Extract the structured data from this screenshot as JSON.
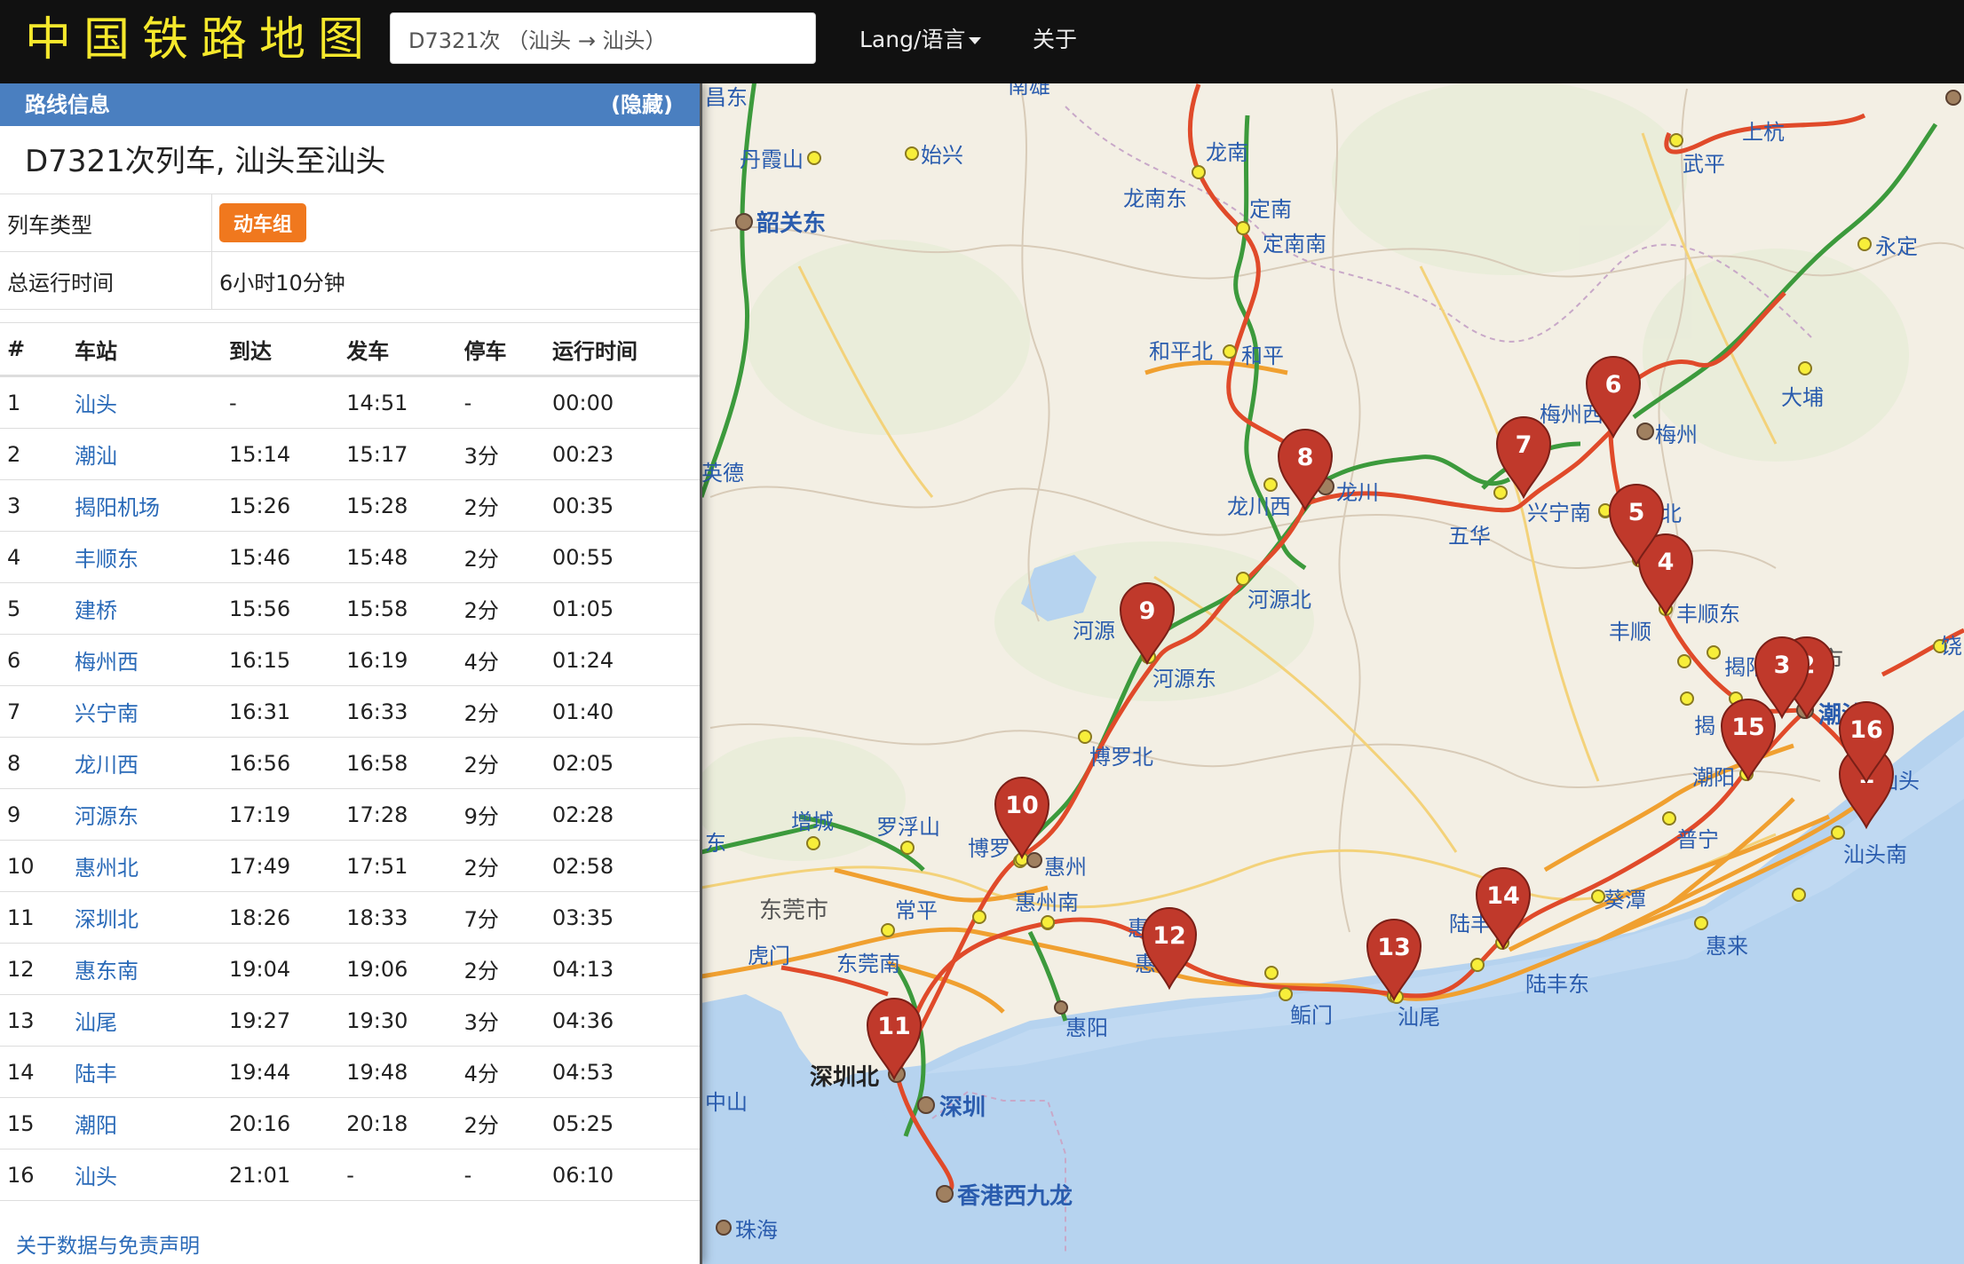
{
  "navbar": {
    "brand": "中国铁路地图",
    "search_value": "D7321次 （汕头 → 汕头）",
    "lang_label": "Lang/语言",
    "about_label": "关于"
  },
  "panel": {
    "header_title": "路线信息",
    "hide_label": "(隐藏)",
    "route_title": "D7321次列车, 汕头至汕头",
    "train_type_label": "列车类型",
    "train_type_value": "动车组",
    "total_time_label": "总运行时间",
    "total_time_value": "6小时10分钟",
    "columns": [
      "#",
      "车站",
      "到达",
      "发车",
      "停车",
      "运行时间"
    ],
    "stops": [
      {
        "n": "1",
        "station": "汕头",
        "arr": "-",
        "dep": "14:51",
        "stop": "-",
        "run": "00:00"
      },
      {
        "n": "2",
        "station": "潮汕",
        "arr": "15:14",
        "dep": "15:17",
        "stop": "3分",
        "run": "00:23"
      },
      {
        "n": "3",
        "station": "揭阳机场",
        "arr": "15:26",
        "dep": "15:28",
        "stop": "2分",
        "run": "00:35"
      },
      {
        "n": "4",
        "station": "丰顺东",
        "arr": "15:46",
        "dep": "15:48",
        "stop": "2分",
        "run": "00:55"
      },
      {
        "n": "5",
        "station": "建桥",
        "arr": "15:56",
        "dep": "15:58",
        "stop": "2分",
        "run": "01:05"
      },
      {
        "n": "6",
        "station": "梅州西",
        "arr": "16:15",
        "dep": "16:19",
        "stop": "4分",
        "run": "01:24"
      },
      {
        "n": "7",
        "station": "兴宁南",
        "arr": "16:31",
        "dep": "16:33",
        "stop": "2分",
        "run": "01:40"
      },
      {
        "n": "8",
        "station": "龙川西",
        "arr": "16:56",
        "dep": "16:58",
        "stop": "2分",
        "run": "02:05"
      },
      {
        "n": "9",
        "station": "河源东",
        "arr": "17:19",
        "dep": "17:28",
        "stop": "9分",
        "run": "02:28"
      },
      {
        "n": "10",
        "station": "惠州北",
        "arr": "17:49",
        "dep": "17:51",
        "stop": "2分",
        "run": "02:58"
      },
      {
        "n": "11",
        "station": "深圳北",
        "arr": "18:26",
        "dep": "18:33",
        "stop": "7分",
        "run": "03:35"
      },
      {
        "n": "12",
        "station": "惠东南",
        "arr": "19:04",
        "dep": "19:06",
        "stop": "2分",
        "run": "04:13"
      },
      {
        "n": "13",
        "station": "汕尾",
        "arr": "19:27",
        "dep": "19:30",
        "stop": "3分",
        "run": "04:36"
      },
      {
        "n": "14",
        "station": "陆丰",
        "arr": "19:44",
        "dep": "19:48",
        "stop": "4分",
        "run": "04:53"
      },
      {
        "n": "15",
        "station": "潮阳",
        "arr": "20:16",
        "dep": "20:18",
        "stop": "2分",
        "run": "05:25"
      },
      {
        "n": "16",
        "station": "汕头",
        "arr": "21:01",
        "dep": "-",
        "stop": "-",
        "run": "06:10"
      }
    ],
    "footer_link": "关于数据与免责声明"
  },
  "map": {
    "colors": {
      "route": "#e04a2a",
      "pin": "#c0392b",
      "rail_green": "#3c9a3c",
      "rail_orange": "#f0a030",
      "sea": "#b6d3ef"
    },
    "pins": [
      "1",
      "2",
      "3",
      "4",
      "5",
      "6",
      "7",
      "8",
      "9",
      "10",
      "11",
      "12",
      "13",
      "14",
      "15",
      "16"
    ],
    "labels": {
      "changdong": "昌东",
      "nanxiong": "南雄",
      "danxiashan": "丹霞山",
      "shixing": "始兴",
      "shaoguandong": "韶关东",
      "longnan": "龙南",
      "longnandong": "龙南东",
      "dingnan": "定南",
      "dingnannan": "定南南",
      "shangkang": "上杭",
      "wuping": "武平",
      "yongding": "永定",
      "heping": "和平",
      "hepingbei": "和平北",
      "dapu": "大埔",
      "meizhouxi": "梅州西",
      "meizhou": "梅州",
      "yingde": "英德",
      "longchuanxi": "龙川西",
      "longchuan": "龙川",
      "xingningnan": "兴宁南",
      "wuhua": "五华",
      "bei": "北",
      "heyuanbei": "河源北",
      "fengshundong": "丰顺东",
      "fengshun": "丰顺",
      "heyuan": "河源",
      "heyuandong": "河源东",
      "jieyang": "揭阳",
      "shi": "市",
      "rao": "饶",
      "chaoshan": "潮汕",
      "jie": "揭",
      "chaoyang": "潮阳",
      "shantou": "汕头",
      "boluobei": "博罗北",
      "zengcheng": "增城",
      "luofushan": "罗浮山",
      "dong": "东",
      "boluo": "博罗",
      "huizhou": "惠州",
      "puning": "普宁",
      "shantounan": "汕头南",
      "dongguanshi": "东莞市",
      "changping": "常平",
      "huizhounan": "惠州南",
      "kuitan": "葵潭",
      "huilai": "惠来",
      "humen": "虎门",
      "dongguannan": "东莞南",
      "hui": "惠",
      "huinan": "惠南",
      "lufeng": "陆丰",
      "lufengdong": "陆丰东",
      "huiyang": "惠阳",
      "jiamen": "鲘门",
      "shanwei": "汕尾",
      "shenzhenbei": "深圳北",
      "zhongshan": "中山",
      "shenzhen": "深圳",
      "xianggang": "香港西九龙",
      "zhuhai": "珠海"
    }
  }
}
